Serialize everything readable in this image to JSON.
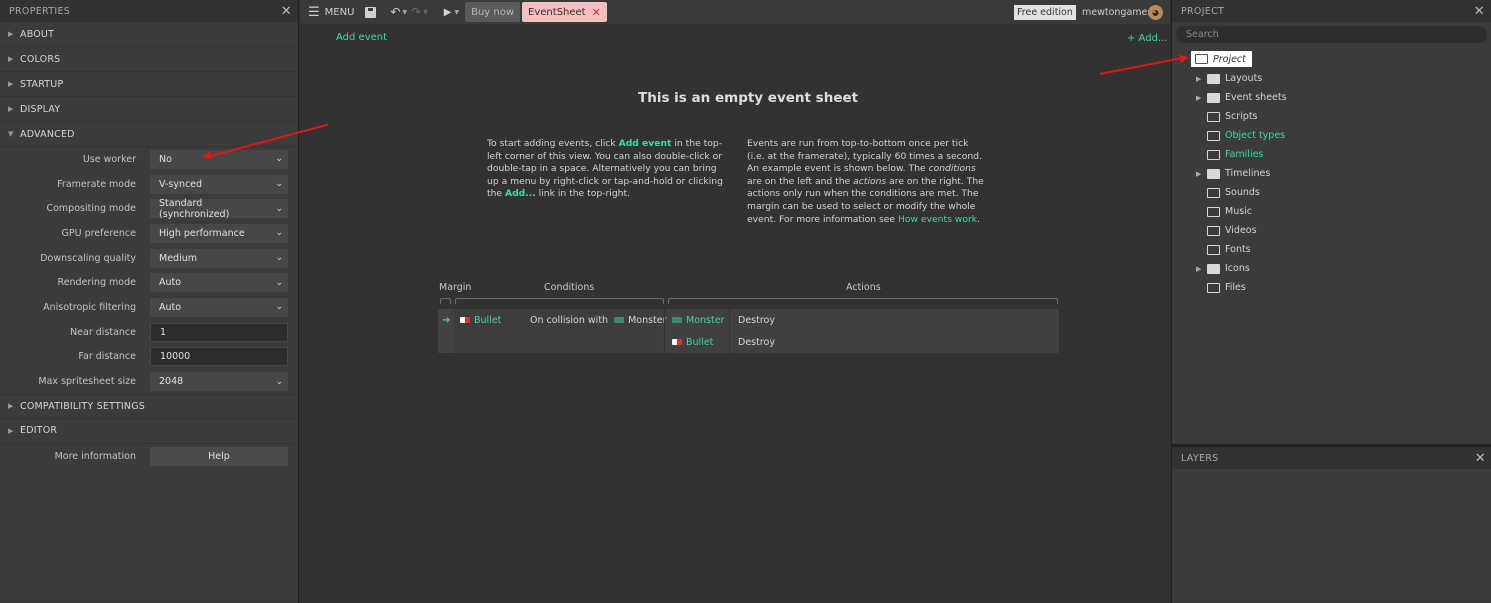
{
  "properties": {
    "title": "PROPERTIES",
    "sections": {
      "about": "ABOUT",
      "colors": "COLORS",
      "startup": "STARTUP",
      "display": "DISPLAY",
      "advanced": "ADVANCED",
      "compat": "COMPATIBILITY SETTINGS",
      "editor": "EDITOR"
    },
    "rows": [
      {
        "label": "Use worker",
        "value": "No"
      },
      {
        "label": "Framerate mode",
        "value": "V-synced"
      },
      {
        "label": "Compositing mode",
        "value": "Standard (synchronized)"
      },
      {
        "label": "GPU preference",
        "value": "High performance"
      },
      {
        "label": "Downscaling quality",
        "value": "Medium"
      },
      {
        "label": "Rendering mode",
        "value": "Auto"
      },
      {
        "label": "Anisotropic filtering",
        "value": "Auto"
      },
      {
        "label": "Near distance",
        "value": "1"
      },
      {
        "label": "Far distance",
        "value": "10000"
      },
      {
        "label": "Max spritesheet size",
        "value": "2048"
      }
    ],
    "more_info_label": "More information",
    "help_button": "Help"
  },
  "toolbar": {
    "menu_label": "MENU",
    "buy_now": "Buy now",
    "tab_eventsheet": "EventSheet",
    "free_edition": "Free edition",
    "username": "mewtongames"
  },
  "sheet": {
    "add_event": "Add event",
    "add_link": "+ Add...",
    "title": "This is an empty event sheet",
    "p1_a": "To start adding events, click ",
    "p1_b": "Add event",
    "p1_c": " in the top-left corner of this view. You can also double-click or double-tap in a space. Alternatively you can bring up a menu by right-click or tap-and-hold or clicking the ",
    "p1_d": "Add...",
    "p1_e": " link in the top-right.",
    "p2_a": "Events are run from top-to-bottom once per tick (i.e. at the framerate), typically 60 times a second. An example event is shown below. The ",
    "p2_b": "conditions",
    "p2_c": " are on the left and the ",
    "p2_d": "actions",
    "p2_e": " are on the right. The actions only run when the conditions are met. The margin can be used to select or modify the whole event. For more information see ",
    "p2_link": "How events work",
    "p2_end": ".",
    "col_margin": "Margin",
    "col_conditions": "Conditions",
    "col_actions": "Actions",
    "cond_object": "Bullet",
    "cond_text": "On collision with",
    "cond_target": "Monster",
    "actions": [
      {
        "object": "Monster",
        "action": "Destroy"
      },
      {
        "object": "Bullet",
        "action": "Destroy"
      }
    ]
  },
  "project": {
    "title": "PROJECT",
    "search_placeholder": "Search",
    "root": "Project",
    "items": [
      {
        "label": "Layouts",
        "expandable": true,
        "filled": true,
        "teal": false
      },
      {
        "label": "Event sheets",
        "expandable": true,
        "filled": true,
        "teal": false
      },
      {
        "label": "Scripts",
        "expandable": false,
        "filled": false,
        "teal": false
      },
      {
        "label": "Object types",
        "expandable": false,
        "filled": false,
        "teal": true
      },
      {
        "label": "Families",
        "expandable": false,
        "filled": false,
        "teal": true
      },
      {
        "label": "Timelines",
        "expandable": true,
        "filled": true,
        "teal": false
      },
      {
        "label": "Sounds",
        "expandable": false,
        "filled": false,
        "teal": false
      },
      {
        "label": "Music",
        "expandable": false,
        "filled": false,
        "teal": false
      },
      {
        "label": "Videos",
        "expandable": false,
        "filled": false,
        "teal": false
      },
      {
        "label": "Fonts",
        "expandable": false,
        "filled": false,
        "teal": false
      },
      {
        "label": "Icons",
        "expandable": true,
        "filled": true,
        "teal": false
      },
      {
        "label": "Files",
        "expandable": false,
        "filled": false,
        "teal": false
      }
    ]
  },
  "layers": {
    "title": "LAYERS"
  },
  "colors": {
    "accent": "#3ed9a8",
    "tab": "#f3c0c0",
    "annotation": "#e01818"
  }
}
